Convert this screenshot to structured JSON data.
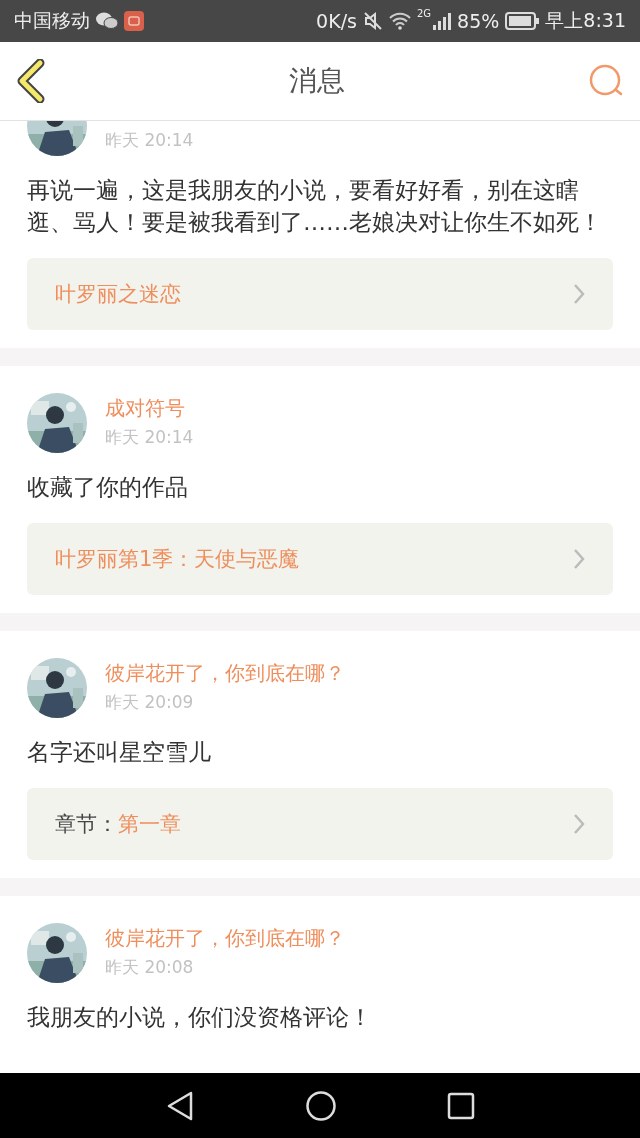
{
  "status_bar": {
    "carrier": "中国移动",
    "speed": "0K/s",
    "network": "2G",
    "battery": "85%",
    "time": "早上8:31"
  },
  "header": {
    "title": "消息"
  },
  "messages": [
    {
      "time": "昨天 20:14",
      "text": "再说一遍，这是我朋友的小说，要看好好看，别在这瞎逛、骂人！要是被我看到了……老娘决对让你生不如死！",
      "link": {
        "kind": "title",
        "value": "叶罗丽之迷恋"
      }
    },
    {
      "name": "成对符号",
      "time": "昨天 20:14",
      "text": "收藏了你的作品",
      "link": {
        "kind": "title",
        "value": "叶罗丽第1季：天使与恶魔"
      }
    },
    {
      "name": "彼岸花开了，你到底在哪？",
      "time": "昨天 20:09",
      "text": "名字还叫星空雪儿",
      "link": {
        "kind": "chapter",
        "label": "章节：",
        "value": "第一章"
      }
    },
    {
      "name": "彼岸花开了，你到底在哪？",
      "time": "昨天 20:08",
      "text": "我朋友的小说，你们没资格评论！"
    }
  ]
}
